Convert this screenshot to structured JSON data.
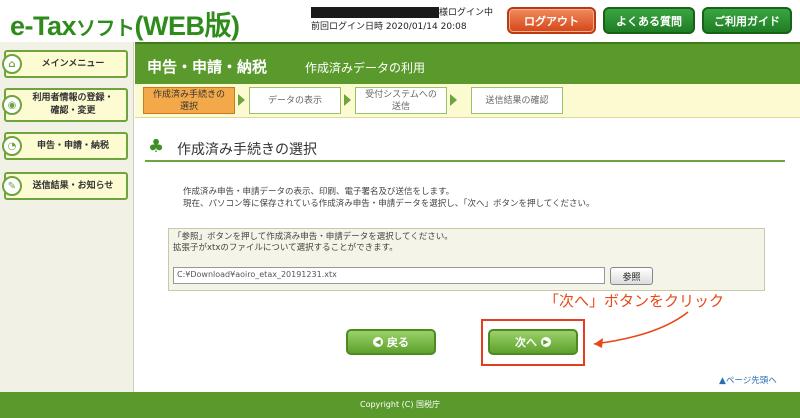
{
  "header": {
    "logo_main": "e-Tax",
    "logo_small": "ソフト",
    "logo_suffix": "(WEB版)",
    "login_status": "様ログイン中",
    "last_login_label": "前回ログイン日時",
    "last_login_time": "2020/01/14 20:08",
    "logout_label": "ログアウト",
    "faq_label": "よくある質問",
    "guide_label": "ご利用ガイド"
  },
  "sidebar": {
    "items": [
      {
        "label": "メインメニュー",
        "icon": "home-icon"
      },
      {
        "label": "利用者情報の登録・\n確認・変更",
        "icon": "user-info-icon"
      },
      {
        "label": "申告・申請・納税",
        "icon": "form-icon"
      },
      {
        "label": "送信結果・お知らせ",
        "icon": "notice-icon"
      }
    ]
  },
  "title": {
    "main": "申告・申請・納税",
    "sub": "作成済みデータの利用"
  },
  "steps": [
    {
      "label": "作成済み手続きの\n選択",
      "active": true
    },
    {
      "label": "データの表示",
      "active": false
    },
    {
      "label": "受付システムへの\n送信",
      "active": false
    },
    {
      "label": "送信結果の確認",
      "active": false
    }
  ],
  "section": {
    "title": "作成済み手続きの選択"
  },
  "description": {
    "line1": "作成済み申告・申請データの表示、印刷、電子署名及び送信をします。",
    "line2": "現在、パソコン等に保存されている作成済み申告・申請データを選択し、「次へ」ボタンを押してください。"
  },
  "file": {
    "help1": "「参照」ボタンを押して作成済み申告・申請データを選択してください。",
    "help2": "拡張子がxtxのファイルについて選択することができます。",
    "path_value": "C:¥Download¥aoiro_etax_20191231.xtx",
    "browse_label": "参照"
  },
  "annotation": {
    "text": "「次へ」ボタンをクリック"
  },
  "nav": {
    "back_label": "戻る",
    "next_label": "次へ"
  },
  "footer": {
    "page_top": "ページ先頭へ",
    "copyright": "Copyright (C) 国税庁"
  },
  "colors": {
    "brand_green": "#5a9a2c",
    "logout_orange": "#d4461a",
    "annotation_red": "#e8491a"
  }
}
